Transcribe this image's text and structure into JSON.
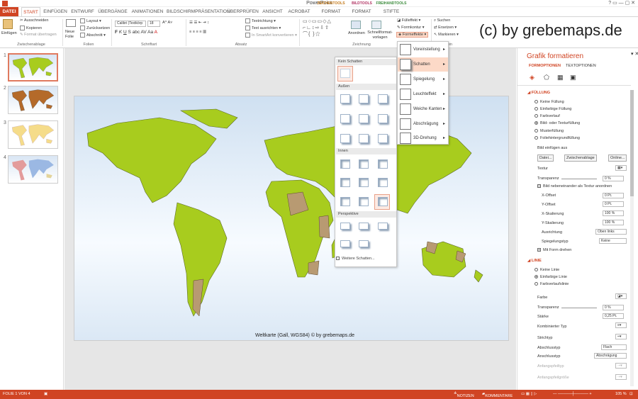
{
  "window": {
    "title": "PowerPoint"
  },
  "contextual_tabs": [
    {
      "label": "ZEICHENTOOLS",
      "color": "#d9a441"
    },
    {
      "label": "BILDTOOLS",
      "color": "#c4587a"
    },
    {
      "label": "FREIHANDTOOLS",
      "color": "#5aa65a"
    }
  ],
  "tabs": [
    "DATEI",
    "START",
    "EINFÜGEN",
    "ENTWURF",
    "ÜBERGÄNGE",
    "ANIMATIONEN",
    "BILDSCHIRMPRÄSENTATION",
    "ÜBERPRÜFEN",
    "ANSICHT",
    "ACROBAT",
    "FORMAT",
    "FORMAT",
    "STIFTE"
  ],
  "ribbon": {
    "clipboard": {
      "paste": "Einfügen",
      "cut": "Ausschneiden",
      "copy": "Kopieren",
      "format_painter": "Format übertragen",
      "label": "Zwischenablage"
    },
    "slides": {
      "new": "Neue Folie",
      "layout": "Layout",
      "reset": "Zurücksetzen",
      "section": "Abschnitt",
      "label": "Folien"
    },
    "font": {
      "name": "Calibri (Textkörp",
      "size": "18",
      "label": "Schriftart"
    },
    "paragraph": {
      "text_direction": "Textrichtung",
      "align_text": "Text ausrichten",
      "smartart": "In SmartArt konvertieren",
      "label": "Absatz"
    },
    "drawing": {
      "arrange": "Anordnen",
      "quick_styles": "Schnellformat-vorlagen",
      "fill": "Fülleffekt",
      "outline": "Formkontur",
      "effects": "Formeffekte",
      "label": "Zeichnung"
    },
    "editing": {
      "find": "Suchen",
      "replace": "Ersetzen",
      "select": "Markieren",
      "label": "Bearbeiten"
    }
  },
  "watermark": "(c) by grebemaps.de",
  "slides": [
    {
      "num": "1"
    },
    {
      "num": "2"
    },
    {
      "num": "3"
    },
    {
      "num": "4"
    }
  ],
  "slide_caption": "Weltkarte (Gall, WGS84) © by grebemaps.de",
  "shadow_gallery": {
    "no_shadow": "Kein Schatten",
    "outer": "Außen",
    "inner": "Innen",
    "perspective": "Perspektive",
    "more": "Weitere Schatten..."
  },
  "effects_menu": [
    "Voreinstellung",
    "Schatten",
    "Spiegelung",
    "Leuchteffekt",
    "Weiche Kanten",
    "Abschrägung",
    "3D-Drehung"
  ],
  "format_pane": {
    "title": "Grafik formatieren",
    "tabs": [
      "FORMOPTIONEN",
      "TEXTOPTIONEN"
    ],
    "fill_header": "FÜLLUNG",
    "fill_options": [
      "Keine Füllung",
      "Einfarbige Füllung",
      "Farbverlauf",
      "Bild- oder Texturfüllung",
      "Musterfüllung",
      "Foliehintergrundfüllung"
    ],
    "insert_from": "Bild einfügen aus",
    "btn_file": "Datei...",
    "btn_clipboard": "Zwischenablage",
    "btn_online": "Online...",
    "texture": "Textur",
    "transparency": "Transparenz",
    "transparency_val": "0 %",
    "tile": "Bild nebeneinander als Textur anordnen",
    "x_offset": "X-Offset",
    "x_offset_val": "0 Pt.",
    "y_offset": "Y-Offset",
    "y_offset_val": "0 Pt.",
    "x_scale": "X-Skalierung",
    "x_scale_val": "100 %",
    "y_scale": "Y-Skalierung",
    "y_scale_val": "100 %",
    "alignment": "Ausrichtung",
    "alignment_val": "Oben links",
    "mirror": "Spiegelungstyp",
    "mirror_val": "Keine",
    "rotate_with": "Mit Form drehen",
    "line_header": "LINIE",
    "line_options": [
      "Keine Linie",
      "Einfarbige Linie",
      "Farbverlaufslinie"
    ],
    "color": "Farbe",
    "line_transparency": "Transparenz",
    "line_transparency_val": "0 %",
    "width": "Stärke",
    "width_val": "0,25 Pt.",
    "compound": "Kombinierter Typ",
    "dash": "Strichtyp",
    "cap": "Abschlusstyp",
    "cap_val": "Flach",
    "join": "Anschlusstyp",
    "join_val": "Abschrägung",
    "begin_arrow_type": "Anfangspfeiltyp",
    "begin_arrow_size": "Anfangspfeilgröße"
  },
  "status": {
    "slide": "FOLIE 1 VON 4",
    "notes": "NOTIZEN",
    "comments": "KOMMENTARE",
    "zoom": "105 %"
  },
  "colors": {
    "accent": "#d04423",
    "land": "#a8cc1e",
    "ocean_top": "#cfe0f1",
    "texture": "#b89a72"
  }
}
